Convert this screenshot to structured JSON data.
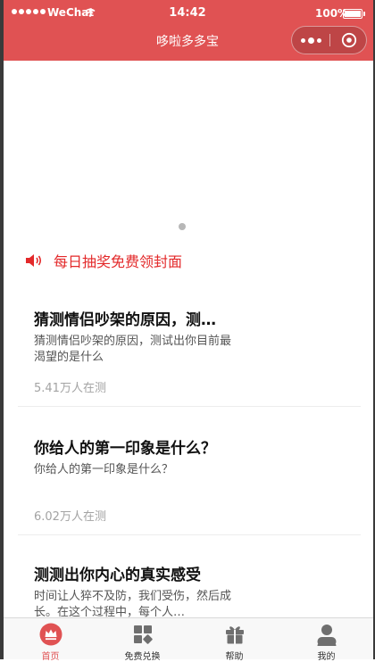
{
  "status_bar": {
    "carrier": "WeChat",
    "time": "14:42",
    "battery": "100%"
  },
  "nav": {
    "title": "哆啦多多宝"
  },
  "notice": {
    "text": "每日抽奖免费领封面"
  },
  "cards": [
    {
      "title": "猜测情侣吵架的原因，测…",
      "desc": "猜测情侣吵架的原因，测试出你目前最渴望的是什么",
      "count": "5.41万人在测"
    },
    {
      "title": "你给人的第一印象是什么？",
      "desc": "你给人的第一印象是什么？",
      "count": "6.02万人在测"
    },
    {
      "title": "测测出你内心的真实感受",
      "desc": "时间让人猝不及防，我们受伤，然后成长。在这个过程中，每个人…",
      "count": ""
    }
  ],
  "tabbar": {
    "tabs": [
      {
        "label": "首页",
        "icon": "crown-icon",
        "active": true
      },
      {
        "label": "免费兑换",
        "icon": "grid-icon",
        "active": false
      },
      {
        "label": "帮助",
        "icon": "gift-icon",
        "active": false
      },
      {
        "label": "我的",
        "icon": "user-icon",
        "active": false
      }
    ]
  },
  "colors": {
    "brand": "#e05253",
    "notice": "#e3292a",
    "muted": "#a3a3a3",
    "tab_inactive": "#6f6f6f"
  }
}
